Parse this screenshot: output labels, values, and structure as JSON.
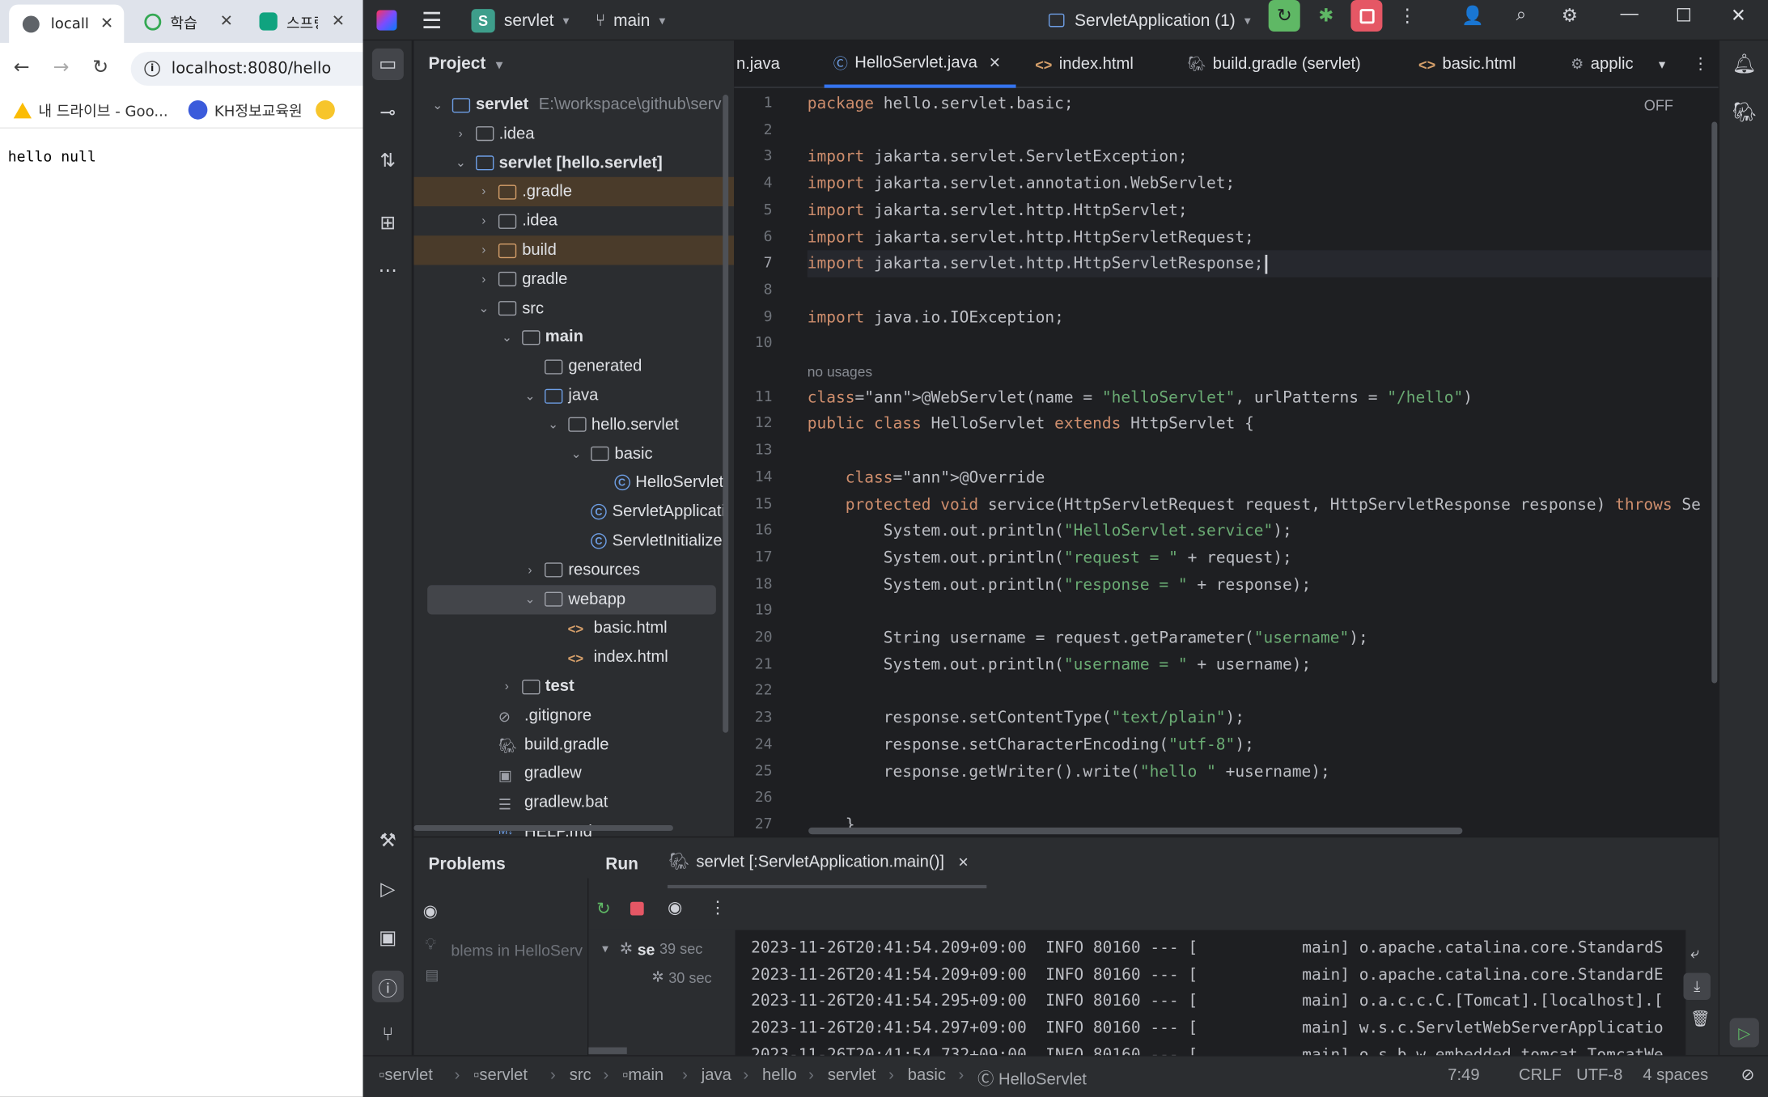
{
  "browser": {
    "tabs": [
      {
        "label": "locall",
        "icon": "globe-icon",
        "active": true
      },
      {
        "label": "학습",
        "icon": "tab-app-icon"
      },
      {
        "label": "스프링",
        "icon": "chatgpt-icon"
      }
    ],
    "url": "localhost:8080/hello",
    "bookmarks": [
      {
        "label": "내 드라이브 - Goo...",
        "icon": "google-drive-icon"
      },
      {
        "label": "KH정보교육원",
        "icon": "kh-logo-icon"
      }
    ],
    "page_text": "hello null"
  },
  "ide": {
    "project_badge": "S",
    "project_name": "servlet",
    "branch": "main",
    "run_config": "ServletApplication (1)",
    "project_panel_title": "Project",
    "tree": [
      {
        "label": "servlet",
        "extra": "E:\\workspace\\github\\serv",
        "depth": 0,
        "chev": "v",
        "icon": "module",
        "bold": true
      },
      {
        "label": ".idea",
        "depth": 1,
        "chev": ">",
        "icon": "folder"
      },
      {
        "label": "servlet [hello.servlet]",
        "depth": 1,
        "chev": "v",
        "icon": "module",
        "bold": true
      },
      {
        "label": ".gradle",
        "depth": 2,
        "chev": ">",
        "icon": "folder-orange",
        "hl": "orange"
      },
      {
        "label": ".idea",
        "depth": 2,
        "chev": ">",
        "icon": "folder"
      },
      {
        "label": "build",
        "depth": 2,
        "chev": ">",
        "icon": "folder-orange",
        "hl": "orange"
      },
      {
        "label": "gradle",
        "depth": 2,
        "chev": ">",
        "icon": "folder"
      },
      {
        "label": "src",
        "depth": 2,
        "chev": "v",
        "icon": "folder"
      },
      {
        "label": "main",
        "depth": 3,
        "chev": "v",
        "icon": "folder",
        "bold": true
      },
      {
        "label": "generated",
        "depth": 4,
        "chev": "",
        "icon": "folder"
      },
      {
        "label": "java",
        "depth": 4,
        "chev": "v",
        "icon": "folder-blue"
      },
      {
        "label": "hello.servlet",
        "depth": 5,
        "chev": "v",
        "icon": "package"
      },
      {
        "label": "basic",
        "depth": 6,
        "chev": "v",
        "icon": "package"
      },
      {
        "label": "HelloServlet",
        "depth": 7,
        "chev": "",
        "icon": "class"
      },
      {
        "label": "ServletApplicati",
        "depth": 6,
        "chev": "",
        "icon": "class"
      },
      {
        "label": "ServletInitializer",
        "depth": 6,
        "chev": "",
        "icon": "class"
      },
      {
        "label": "resources",
        "depth": 4,
        "chev": ">",
        "icon": "folder"
      },
      {
        "label": "webapp",
        "depth": 4,
        "chev": "v",
        "icon": "folder",
        "hl": "sel"
      },
      {
        "label": "basic.html",
        "depth": 5,
        "chev": "",
        "icon": "html"
      },
      {
        "label": "index.html",
        "depth": 5,
        "chev": "",
        "icon": "html"
      },
      {
        "label": "test",
        "depth": 3,
        "chev": ">",
        "icon": "folder",
        "bold": true
      },
      {
        "label": ".gitignore",
        "depth": 2,
        "chev": "",
        "icon": "ignore"
      },
      {
        "label": "build.gradle",
        "depth": 2,
        "chev": "",
        "icon": "gradle"
      },
      {
        "label": "gradlew",
        "depth": 2,
        "chev": "",
        "icon": "terminal"
      },
      {
        "label": "gradlew.bat",
        "depth": 2,
        "chev": "",
        "icon": "lines"
      },
      {
        "label": "HELP.md",
        "depth": 2,
        "chev": "",
        "icon": "md"
      }
    ],
    "editor_tabs": [
      {
        "label": "n.java",
        "icon": ""
      },
      {
        "label": "HelloServlet.java",
        "icon": "C",
        "active": true,
        "closable": true
      },
      {
        "label": "index.html",
        "icon": "<>"
      },
      {
        "label": "build.gradle (servlet)",
        "icon": "G"
      },
      {
        "label": "basic.html",
        "icon": "<>"
      },
      {
        "label": "applic",
        "icon": "⚙"
      }
    ],
    "inlay_off": "OFF",
    "no_usages": "no usages",
    "code_lines": [
      {
        "n": "1",
        "t": "package hello.servlet.basic;"
      },
      {
        "n": "2",
        "t": ""
      },
      {
        "n": "3",
        "t": "import jakarta.servlet.ServletException;"
      },
      {
        "n": "4",
        "t": "import jakarta.servlet.annotation.WebServlet;"
      },
      {
        "n": "5",
        "t": "import jakarta.servlet.http.HttpServlet;"
      },
      {
        "n": "6",
        "t": "import jakarta.servlet.http.HttpServletRequest;"
      },
      {
        "n": "7",
        "t": "import jakarta.servlet.http.HttpServletResponse;"
      },
      {
        "n": "8",
        "t": ""
      },
      {
        "n": "9",
        "t": "import java.io.IOException;"
      },
      {
        "n": "10",
        "t": ""
      },
      {
        "n": "11",
        "t": "@WebServlet(name = \"helloServlet\", urlPatterns = \"/hello\")"
      },
      {
        "n": "12",
        "t": "public class HelloServlet extends HttpServlet {"
      },
      {
        "n": "13",
        "t": ""
      },
      {
        "n": "14",
        "t": "    @Override"
      },
      {
        "n": "15",
        "t": "    protected void service(HttpServletRequest request, HttpServletResponse response) throws Se"
      },
      {
        "n": "16",
        "t": "        System.out.println(\"HelloServlet.service\");"
      },
      {
        "n": "17",
        "t": "        System.out.println(\"request = \" + request);"
      },
      {
        "n": "18",
        "t": "        System.out.println(\"response = \" + response);"
      },
      {
        "n": "19",
        "t": ""
      },
      {
        "n": "20",
        "t": "        String username = request.getParameter(\"username\");"
      },
      {
        "n": "21",
        "t": "        System.out.println(\"username = \" + username);"
      },
      {
        "n": "22",
        "t": ""
      },
      {
        "n": "23",
        "t": "        response.setContentType(\"text/plain\");"
      },
      {
        "n": "24",
        "t": "        response.setCharacterEncoding(\"utf-8\");"
      },
      {
        "n": "25",
        "t": "        response.getWriter().write(\"hello \" +username);"
      },
      {
        "n": "26",
        "t": ""
      },
      {
        "n": "27",
        "t": "    }"
      }
    ],
    "bottom": {
      "problems_label": "Problems",
      "problems_text": "blems in HelloServ",
      "run_label": "Run",
      "run_tab": "servlet [:ServletApplication.main()]",
      "run_tree": [
        {
          "label": "se",
          "time": "39 sec"
        },
        {
          "label": "",
          "time": "30 sec"
        }
      ],
      "console": [
        "2023-11-26T20:41:54.209+09:00  INFO 80160 --- [           main] o.apache.catalina.core.StandardS",
        "2023-11-26T20:41:54.209+09:00  INFO 80160 --- [           main] o.apache.catalina.core.StandardE",
        "2023-11-26T20:41:54.295+09:00  INFO 80160 --- [           main] o.a.c.c.C.[Tomcat].[localhost].[",
        "2023-11-26T20:41:54.297+09:00  INFO 80160 --- [           main] w.s.c.ServletWebServerApplicatio",
        "2023-11-26T20:41:54.732+09:00  INFO 80160 --- [           main] o.s.b.w.embedded.tomcat.TomcatWe"
      ]
    },
    "breadcrumbs": [
      "servlet",
      "servlet",
      "src",
      "main",
      "java",
      "hello",
      "servlet",
      "basic",
      "HelloServlet"
    ],
    "status": {
      "position": "7:49",
      "line_sep": "CRLF",
      "encoding": "UTF-8",
      "indent": "4 spaces"
    },
    "colors": {
      "accent": "#3574f0",
      "run_green": "#5fb865",
      "stop_red": "#e55765"
    }
  }
}
